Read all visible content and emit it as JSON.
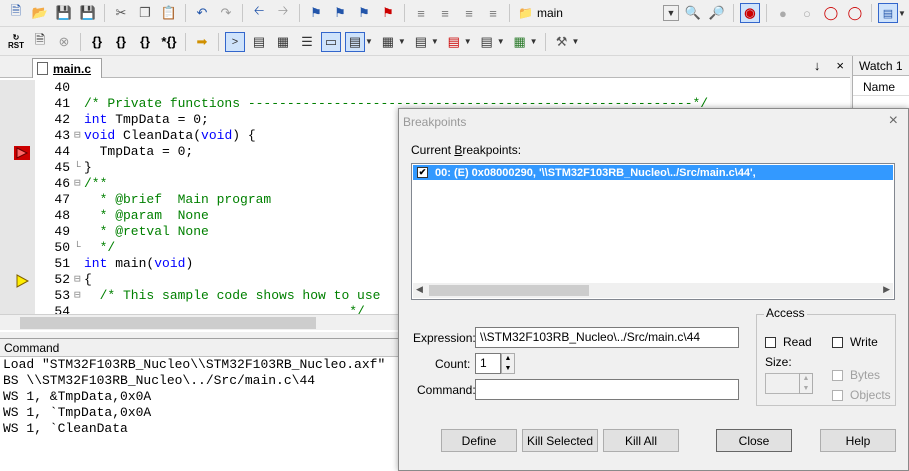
{
  "toolbar": {
    "target": "main",
    "rst_label": "RST"
  },
  "editor": {
    "tab_label": "main.c",
    "pin": "↓",
    "close": "×",
    "lines": [
      {
        "num": "40",
        "fold": "",
        "parts": [
          {
            "t": "",
            "c": ""
          }
        ]
      },
      {
        "num": "41",
        "fold": "",
        "parts": [
          {
            "t": "/* Private functions ---------------------------------------------------------*/",
            "c": "cm"
          }
        ]
      },
      {
        "num": "42",
        "fold": "",
        "parts": [
          {
            "t": "int",
            "c": "kw"
          },
          {
            "t": " TmpData = 0;",
            "c": ""
          }
        ]
      },
      {
        "num": "43",
        "fold": "⊟",
        "parts": [
          {
            "t": "void",
            "c": "kw"
          },
          {
            "t": " CleanData(",
            "c": ""
          },
          {
            "t": "void",
            "c": "kw"
          },
          {
            "t": ") {",
            "c": ""
          }
        ]
      },
      {
        "num": "44",
        "fold": "",
        "parts": [
          {
            "t": "  TmpData = 0;",
            "c": ""
          }
        ]
      },
      {
        "num": "45",
        "fold": "└",
        "parts": [
          {
            "t": "}",
            "c": ""
          }
        ]
      },
      {
        "num": "46",
        "fold": "⊟",
        "parts": [
          {
            "t": "/**",
            "c": "cm"
          }
        ]
      },
      {
        "num": "47",
        "fold": "",
        "parts": [
          {
            "t": "  * @brief  Main program",
            "c": "cm"
          }
        ]
      },
      {
        "num": "48",
        "fold": "",
        "parts": [
          {
            "t": "  * @param  None",
            "c": "cm"
          }
        ]
      },
      {
        "num": "49",
        "fold": "",
        "parts": [
          {
            "t": "  * @retval None",
            "c": "cm"
          }
        ]
      },
      {
        "num": "50",
        "fold": "└",
        "parts": [
          {
            "t": "  */",
            "c": "cm"
          }
        ]
      },
      {
        "num": "51",
        "fold": "",
        "parts": [
          {
            "t": "int",
            "c": "kw"
          },
          {
            "t": " main(",
            "c": ""
          },
          {
            "t": "void",
            "c": "kw"
          },
          {
            "t": ")",
            "c": ""
          }
        ]
      },
      {
        "num": "52",
        "fold": "⊟",
        "parts": [
          {
            "t": "{",
            "c": ""
          }
        ]
      },
      {
        "num": "53",
        "fold": "⊟",
        "parts": [
          {
            "t": "  /* This sample code shows how to use",
            "c": "cm"
          }
        ]
      },
      {
        "num": "54",
        "fold": "",
        "parts": [
          {
            "t": "                                  */",
            "c": "cm"
          }
        ]
      }
    ]
  },
  "watch": {
    "title": "Watch 1",
    "col_name": "Name"
  },
  "command": {
    "title": "Command",
    "lines": [
      "Load \"STM32F103RB_Nucleo\\\\STM32F103RB_Nucleo.axf\"",
      "BS \\\\STM32F103RB_Nucleo\\../Src/main.c\\44",
      "WS 1, &TmpData,0x0A",
      "WS 1, `TmpData,0x0A",
      "WS 1, `CleanData"
    ]
  },
  "dialog": {
    "title": "Breakpoints",
    "close": "×",
    "current_label_pre": "Current ",
    "current_label_key": "B",
    "current_label_post": "reakpoints:",
    "breakpoint": "00: (E) 0x08000290,  '\\\\STM32F103RB_Nucleo\\../Src/main.c\\44',",
    "expression_label": "Expression:",
    "expression_value": "\\\\STM32F103RB_Nucleo\\../Src/main.c\\44",
    "count_label": "Count:",
    "count_value": "1",
    "command_label": "Command:",
    "command_value": "",
    "access_label": "Access",
    "read": "Read",
    "write": "Write",
    "size": "Size:",
    "bytes": "Bytes",
    "objects": "Objects",
    "buttons": {
      "define": "Define",
      "kill_selected": "Kill Selected",
      "kill_all": "Kill All",
      "close": "Close",
      "help": "Help"
    }
  }
}
